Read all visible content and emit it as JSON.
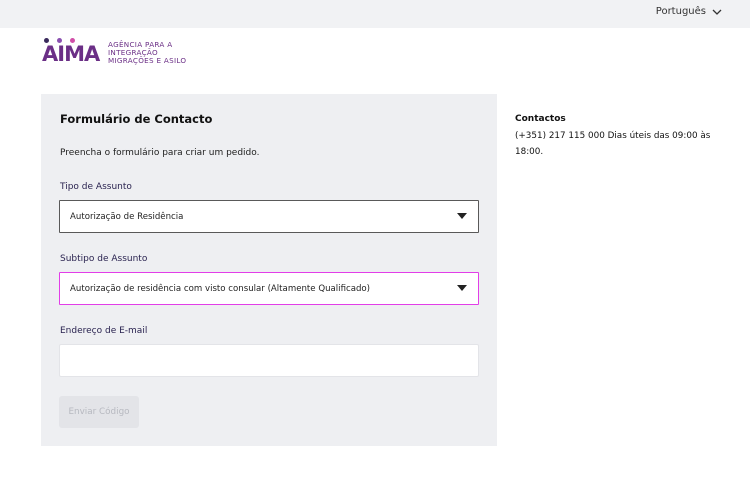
{
  "topbar": {
    "language": "Português"
  },
  "logo": {
    "wordmark": "AIMA",
    "lines": [
      "AGÊNCIA PARA A",
      "INTEGRAÇÃO",
      "MIGRAÇÕES E ASILO"
    ],
    "colors": {
      "primary": "#6b2f86",
      "dot1": "#3a2a5c",
      "dot2": "#8a4fb0",
      "dot3": "#d14fa8"
    }
  },
  "form": {
    "title": "Formulário de Contacto",
    "intro": "Preencha o formulário para criar um pedido.",
    "subject_type": {
      "label": "Tipo de Assunto",
      "value": "Autorização de Residência"
    },
    "subject_subtype": {
      "label": "Subtipo de Assunto",
      "value": "Autorização de residência com visto consular (Altamente Qualificado)"
    },
    "email": {
      "label": "Endereço de E-mail",
      "value": "",
      "placeholder": ""
    },
    "submit_label": "Enviar Código"
  },
  "contacts": {
    "title": "Contactos",
    "text": "(+351) 217 115 000 Dias úteis das 09:00 às 18:00."
  }
}
